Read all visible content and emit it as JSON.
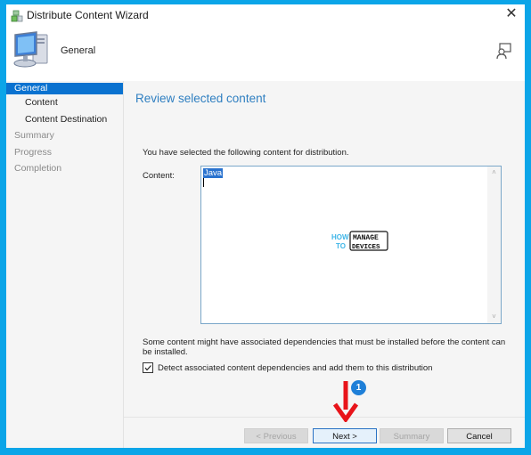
{
  "window": {
    "title": "Distribute Content Wizard",
    "close_label": "✕"
  },
  "header": {
    "title": "General",
    "icon": "computer-icon",
    "help_icon": "help-user-icon"
  },
  "sidebar": {
    "items": [
      {
        "label": "General",
        "state": "active"
      },
      {
        "label": "Content",
        "state": "sub"
      },
      {
        "label": "Content Destination",
        "state": "sub"
      },
      {
        "label": "Summary",
        "state": "inactive"
      },
      {
        "label": "Progress",
        "state": "inactive"
      },
      {
        "label": "Completion",
        "state": "inactive"
      }
    ]
  },
  "main": {
    "page_title": "Review selected content",
    "intro": "You have selected the following content for distribution.",
    "content_label": "Content:",
    "content_value": "Java",
    "scroll_up": "˄",
    "scroll_down": "˅",
    "watermark": {
      "how": "HOW",
      "to": "TO",
      "manage": "MANAGE",
      "devices": "DEVICES"
    },
    "dependency_note": "Some content might have associated dependencies that must be installed before the content can be installed.",
    "checkbox": {
      "label": "Detect associated content dependencies and add them to this distribution",
      "checked": true
    }
  },
  "buttons": {
    "previous": "< Previous",
    "next": "Next >",
    "summary": "Summary",
    "cancel": "Cancel"
  },
  "annotation": {
    "badge": "1",
    "arrow_color": "#e8141a",
    "badge_color": "#1e7fd8"
  },
  "colors": {
    "frame": "#0ba5e8",
    "accent": "#0a72d0",
    "title_blue": "#2f7fc1"
  }
}
